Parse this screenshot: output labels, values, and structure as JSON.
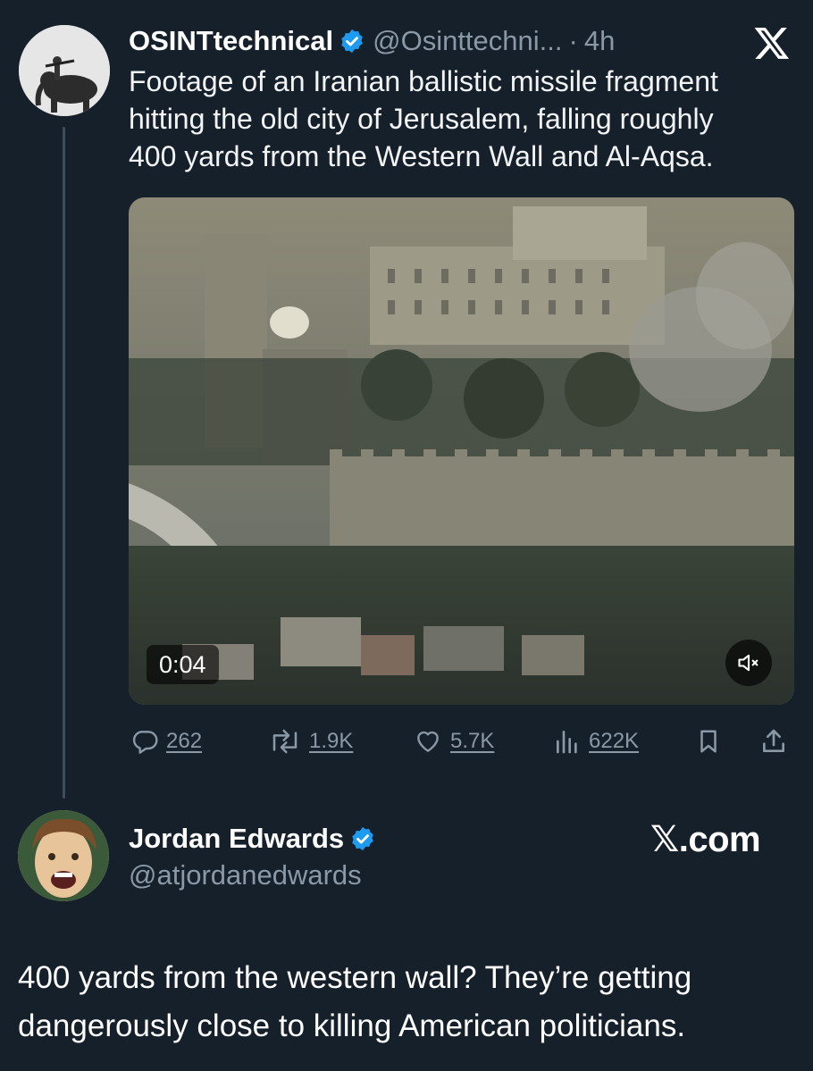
{
  "quoted_tweet": {
    "author_name": "OSINTtechnical",
    "handle": "@Osinttechni...",
    "separator": "·",
    "time": "4h",
    "text_lines": [
      "Footage of an Iranian ballistic missile fragment",
      "hitting the old city of Jerusalem, falling roughly",
      "400 yards from the Western Wall and Al-Aqsa."
    ],
    "video": {
      "duration": "0:04",
      "mute_icon": "speaker-muted-icon"
    },
    "actions": {
      "replies": "262",
      "reposts": "1.9K",
      "likes": "5.7K",
      "views": "622K"
    }
  },
  "author": {
    "name": "Jordan Edwards",
    "handle": "@atjordanedwards",
    "brand": "𝕏.com"
  },
  "post_text_lines": [
    "400 yards from the western wall? They’re getting",
    "dangerously close to killing American politicians."
  ],
  "colors": {
    "background": "#15202b",
    "muted_text": "#8b98a5",
    "verified_blue": "#1d9bf0",
    "thread_line": "#3c4d5c"
  }
}
